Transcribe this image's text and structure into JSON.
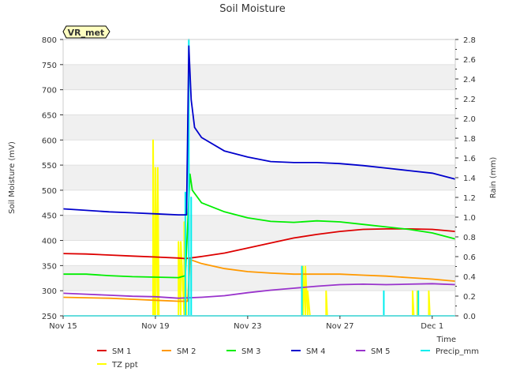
{
  "chart_data": {
    "type": "line",
    "title": "Soil Moisture",
    "badge": "VR_met",
    "xlabel": "Time",
    "ylabel": "Soil Moisture (mV)",
    "y2label": "Rain (mm)",
    "xlim": [
      0,
      17
    ],
    "ylim": [
      250,
      800
    ],
    "y2lim": [
      0,
      2.8
    ],
    "x_unit": "days after Nov 15",
    "x_ticks": [
      {
        "x": 0,
        "label": "Nov 15"
      },
      {
        "x": 4,
        "label": "Nov 19"
      },
      {
        "x": 8,
        "label": "Nov 23"
      },
      {
        "x": 12,
        "label": "Nov 27"
      },
      {
        "x": 16,
        "label": "Dec 1"
      }
    ],
    "y_ticks": [
      250,
      300,
      350,
      400,
      450,
      500,
      550,
      600,
      650,
      700,
      750,
      800
    ],
    "y2_ticks": [
      "0.0",
      "0.2",
      "0.4",
      "0.6",
      "0.8",
      "1.0",
      "1.2",
      "1.4",
      "1.6",
      "1.8",
      "2.0",
      "2.2",
      "2.4",
      "2.6",
      "2.8"
    ],
    "grid": "horizontal bands",
    "legend_position": "bottom",
    "series": [
      {
        "name": "SM 1",
        "color": "#dd0000",
        "axis": "left",
        "x": [
          0,
          1,
          2,
          3,
          4,
          5,
          5.3,
          5.5,
          6,
          7,
          8,
          9,
          10,
          11,
          12,
          13,
          14,
          15,
          16,
          17
        ],
        "y": [
          374,
          373,
          371,
          369,
          367,
          365,
          364,
          365,
          368,
          375,
          385,
          395,
          405,
          412,
          418,
          422,
          423,
          423,
          422,
          418
        ]
      },
      {
        "name": "SM 2",
        "color": "#ff9900",
        "axis": "left",
        "x": [
          0,
          1,
          2,
          3,
          4,
          5,
          5.4,
          5.5,
          6,
          7,
          8,
          9,
          10,
          11,
          12,
          13,
          14,
          15,
          16,
          17
        ],
        "y": [
          287,
          286,
          285,
          283,
          281,
          279,
          279,
          362,
          354,
          344,
          338,
          335,
          333,
          333,
          333,
          331,
          329,
          326,
          323,
          319
        ]
      },
      {
        "name": "SM 3",
        "color": "#00ee00",
        "axis": "left",
        "x": [
          0,
          1,
          2,
          3,
          4,
          5,
          5.3,
          5.5,
          5.6,
          6,
          7,
          8,
          9,
          10,
          11,
          12,
          13,
          14,
          15,
          16,
          17
        ],
        "y": [
          333,
          333,
          330,
          328,
          327,
          326,
          330,
          532,
          500,
          475,
          457,
          445,
          438,
          436,
          439,
          437,
          432,
          427,
          422,
          415,
          403
        ]
      },
      {
        "name": "SM 4",
        "color": "#0000cc",
        "axis": "left",
        "x": [
          0,
          1,
          2,
          3,
          4,
          5,
          5.35,
          5.45,
          5.55,
          5.7,
          6,
          7,
          8,
          9,
          10,
          11,
          12,
          13,
          14,
          15,
          16,
          17
        ],
        "y": [
          463,
          460,
          457,
          455,
          453,
          451,
          451,
          787,
          680,
          625,
          605,
          578,
          566,
          557,
          555,
          555,
          553,
          549,
          544,
          539,
          534,
          522
        ]
      },
      {
        "name": "SM 5",
        "color": "#9933cc",
        "axis": "left",
        "x": [
          0,
          1,
          2,
          3,
          4,
          5,
          6,
          7,
          8,
          9,
          10,
          11,
          12,
          13,
          14,
          15,
          16,
          17
        ],
        "y": [
          295,
          293,
          291,
          289,
          288,
          285,
          287,
          290,
          296,
          301,
          305,
          309,
          312,
          313,
          312,
          313,
          314,
          312
        ]
      },
      {
        "name": "Precip_mm",
        "color": "#00eeee",
        "axis": "right",
        "x": [
          0,
          5.3,
          5.3,
          5.3,
          5.45,
          5.45,
          5.45,
          5.55,
          5.55,
          5.55,
          10.35,
          10.35,
          10.35,
          13.9,
          13.9,
          13.9,
          15.4,
          15.4,
          15.4,
          17
        ],
        "y": [
          0,
          0,
          1.25,
          0,
          0,
          2.8,
          0,
          0,
          1.2,
          0,
          0,
          0.5,
          0,
          0,
          0.25,
          0,
          0,
          0.25,
          0,
          0
        ]
      },
      {
        "name": "TZ ppt",
        "color": "#ffff00",
        "axis": "right",
        "x": [
          0,
          3.9,
          3.9,
          3.95,
          4.0,
          4.0,
          4.1,
          4.1,
          4.15,
          5.0,
          5.0,
          5.1,
          5.1,
          5.25,
          5.25,
          5.35,
          10.4,
          10.4,
          10.5,
          10.5,
          10.6,
          10.6,
          10.7,
          11.4,
          11.4,
          11.45,
          15.15,
          15.15,
          15.2,
          15.35,
          15.35,
          15.4,
          15.85,
          15.85,
          15.9,
          17
        ],
        "y": [
          0,
          0,
          1.78,
          0,
          0,
          1.5,
          0,
          1.5,
          0,
          0,
          0.75,
          0,
          0.75,
          0,
          0.95,
          0,
          0,
          0.5,
          0,
          0.5,
          0,
          0.25,
          0,
          0,
          0.25,
          0,
          0,
          0.25,
          0,
          0,
          0.25,
          0,
          0,
          0.25,
          0,
          0
        ]
      }
    ]
  }
}
